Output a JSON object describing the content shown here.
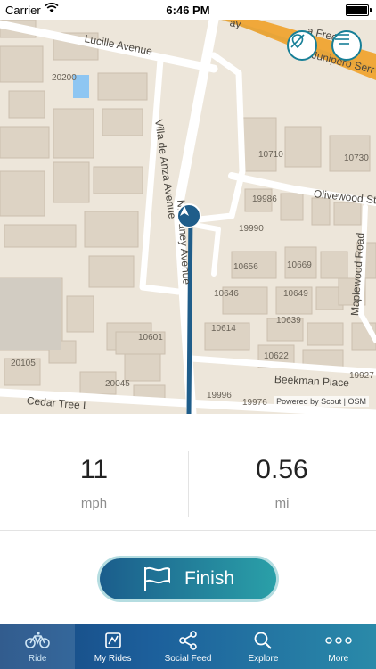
{
  "status_bar": {
    "carrier": "Carrier",
    "time": "6:46 PM"
  },
  "map": {
    "street_labels": {
      "lucille": "Lucille Avenue",
      "villa_de_anza": "Villa de Anza Avenue",
      "blaney": "N. Blaney Avenue",
      "olivewood": "Olivewood St",
      "maplewood": "Maplewood Road",
      "beekman": "Beekman Place",
      "cedar_tree": "Cedar Tree L",
      "freeway_top": "a Free",
      "junipero": "Junipero Serr",
      "way_fragment": "ay"
    },
    "address_labels": {
      "a20200": "20200",
      "a10710": "10710",
      "a10730": "10730",
      "a19986": "19986",
      "a19990": "19990",
      "a10656": "10656",
      "a10669": "10669",
      "a10646": "10646",
      "a10649": "10649",
      "a10639": "10639",
      "a10614": "10614",
      "a10601": "10601",
      "a10622": "10622",
      "a20105": "20105",
      "a20045": "20045",
      "a19927": "19927",
      "a19996": "19996",
      "a19976": "19976"
    },
    "attribution": "Powered by Scout | OSM",
    "location_button_icon": "location-off-icon",
    "menu_button_icon": "menu-icon",
    "route_color": "#1f5d8a"
  },
  "stats": {
    "speed": {
      "value": "11",
      "unit": "mph"
    },
    "distance": {
      "value": "0.56",
      "unit": "mi"
    }
  },
  "finish_button": {
    "label": "Finish",
    "icon": "flag-icon"
  },
  "tab_bar": {
    "items": [
      {
        "label": "Ride",
        "icon": "bicycle-icon",
        "active": true
      },
      {
        "label": "My Rides",
        "icon": "my-rides-icon"
      },
      {
        "label": "Social Feed",
        "icon": "share-icon"
      },
      {
        "label": "Explore",
        "icon": "search-icon"
      },
      {
        "label": "More",
        "icon": "more-icon"
      }
    ]
  }
}
